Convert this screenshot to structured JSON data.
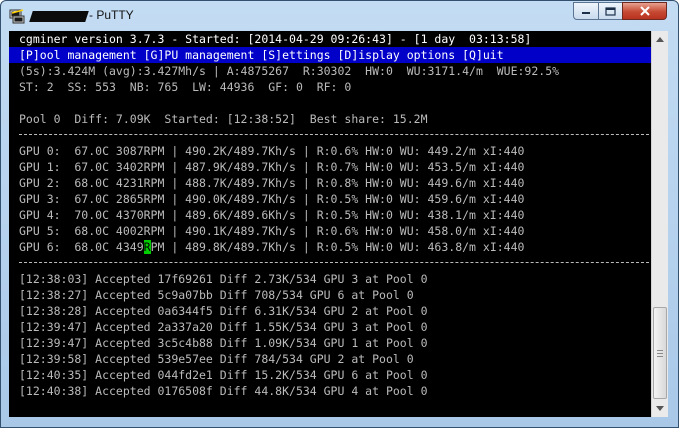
{
  "window": {
    "title": "- PuTTY",
    "controls": {
      "minimize": "minimize",
      "maximize": "maximize",
      "close": "close"
    }
  },
  "terminal": {
    "header": "cgminer version 3.7.3 - Started: [2014-04-29 09:26:43] - [1 day  03:13:58]",
    "menu": "[P]ool management [G]PU management [S]ettings [D]isplay options [Q]uit",
    "stats1": "(5s):3.424M (avg):3.427Mh/s | A:4875267  R:30302  HW:0  WU:3171.4/m  WUE:92.5%",
    "stats2": "ST: 2  SS: 553  NB: 765  LW: 44936  GF: 0  RF: 0",
    "pool": "Pool 0  Diff: 7.09K  Started: [12:38:52]  Best share: 15.2M",
    "gpus": [
      "GPU 0:  67.0C 3087RPM | 490.2K/489.7Kh/s | R:0.6% HW:0 WU: 449.2/m xI:440",
      "GPU 1:  67.0C 3402RPM | 487.9K/489.7Kh/s | R:0.7% HW:0 WU: 453.5/m xI:440",
      "GPU 2:  68.0C 4231RPM | 488.7K/489.7Kh/s | R:0.8% HW:0 WU: 449.6/m xI:440",
      "GPU 3:  67.0C 2865RPM | 490.0K/489.7Kh/s | R:0.5% HW:0 WU: 459.6/m xI:440",
      "GPU 4:  70.0C 4370RPM | 489.6K/489.6Kh/s | R:0.5% HW:0 WU: 438.1/m xI:440",
      "GPU 5:  68.0C 4002RPM | 490.1K/489.7Kh/s | R:0.6% HW:0 WU: 458.0/m xI:440"
    ],
    "gpu6": {
      "before": "GPU 6:  68.0C 4349",
      "cursor_char": "R",
      "after": "PM | 489.8K/489.7Kh/s | R:0.5% HW:0 WU: 463.8/m xI:440"
    },
    "log": [
      "[12:38:03] Accepted 17f69261 Diff 2.73K/534 GPU 3 at Pool 0",
      "[12:38:27] Accepted 5c9a07bb Diff 708/534 GPU 6 at Pool 0",
      "[12:38:28] Accepted 0a6344f5 Diff 6.31K/534 GPU 2 at Pool 0",
      "[12:39:47] Accepted 2a337a20 Diff 1.55K/534 GPU 3 at Pool 0",
      "[12:39:47] Accepted 3c5c4b88 Diff 1.09K/534 GPU 1 at Pool 0",
      "[12:39:58] Accepted 539e57ee Diff 784/534 GPU 2 at Pool 0",
      "[12:40:35] Accepted 044fd2e1 Diff 15.2K/534 GPU 6 at Pool 0",
      "[12:40:38] Accepted 0176508f Diff 44.8K/534 GPU 4 at Pool 0"
    ]
  },
  "colors": {
    "terminal_bg": "#000000",
    "terminal_fg": "#bbbbbb",
    "menu_bg": "#0000c8",
    "cursor": "#00cc00"
  }
}
